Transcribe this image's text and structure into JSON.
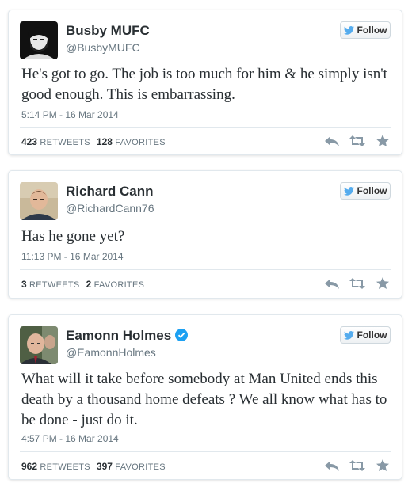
{
  "colors": {
    "name": "#292f33",
    "meta": "#66757f",
    "twitter_blue": "#55acee",
    "verified_blue": "#1da1f2",
    "icon_gray": "#8899a6"
  },
  "tweets": [
    {
      "name": "Busby MUFC",
      "handle": "@BusbyMUFC",
      "verified": false,
      "follow_label": "Follow",
      "text": "He's got to go. The job is too much for him & he simply isn't good enough. This is embarrassing.",
      "timestamp": "5:14 PM - 16 Mar 2014",
      "retweets": "423",
      "retweets_label": "RETWEETS",
      "favorites": "128",
      "favorites_label": "FAVORITES",
      "avatar_icon": "bearded-man-portrait"
    },
    {
      "name": "Richard Cann",
      "handle": "@RichardCann76",
      "verified": false,
      "follow_label": "Follow",
      "text": "Has he gone yet?",
      "timestamp": "11:13 PM - 16 Mar 2014",
      "retweets": "3",
      "retweets_label": "RETWEETS",
      "favorites": "2",
      "favorites_label": "FAVORITES",
      "avatar_icon": "man-portrait"
    },
    {
      "name": "Eamonn Holmes",
      "handle": "@EamonnHolmes",
      "verified": true,
      "follow_label": "Follow",
      "text": "What will it take before somebody at Man United ends this death by a thousand home defeats ? We all know what has to be done - just do it.",
      "timestamp": "4:57 PM - 16 Mar 2014",
      "retweets": "962",
      "retweets_label": "RETWEETS",
      "favorites": "397",
      "favorites_label": "FAVORITES",
      "avatar_icon": "man-portrait"
    }
  ],
  "action_icons": [
    "reply-icon",
    "retweet-icon",
    "favorite-star-icon"
  ]
}
